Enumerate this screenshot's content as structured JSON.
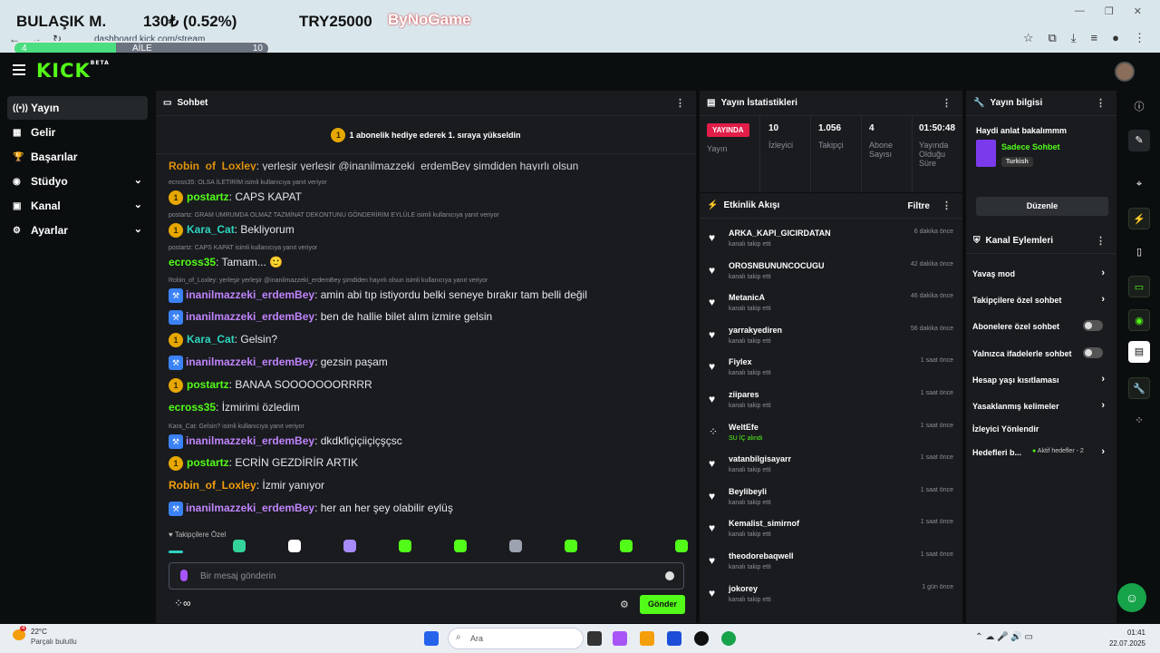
{
  "browser": {
    "url": "dashboard.kick.com/stream",
    "ticker": {
      "stock": "BULAŞIK M.",
      "change": "130₺ (0.52%)",
      "goal": "TRY25000",
      "brand": "ByNoGame"
    },
    "progress": {
      "left": "4",
      "label": "AİLE",
      "right": "10",
      "fill_fraction": 0.4
    }
  },
  "header": {
    "logo": "KICK",
    "logo_sup": "BETA"
  },
  "nav": {
    "items": [
      {
        "label": "Yayın",
        "icon": "broadcast-icon"
      },
      {
        "label": "Gelir",
        "icon": "revenue-icon"
      },
      {
        "label": "Başarılar",
        "icon": "trophy-icon"
      },
      {
        "label": "Stüdyo",
        "icon": "studio-icon"
      },
      {
        "label": "Kanal",
        "icon": "channel-icon"
      },
      {
        "label": "Ayarlar",
        "icon": "gear-icon"
      }
    ]
  },
  "chat": {
    "title": "Sohbet",
    "pinned": "1 abonelik hediye ederek 1. sıraya yükseldin",
    "pinned_badge": "1",
    "top_partial": {
      "user": "Robin_of_Loxley",
      "text": ": yerleşir yerleşir @inanilmazzeki_erdemBey şimdiden hayırlı olsun"
    },
    "messages": [
      {
        "reply": "ecross35: OLSA İLETİRİM isimli kullanıcıya yanıt veriyor",
        "badge": "1",
        "user": "postartz",
        "color": "#53fc18",
        "text": ": CAPS KAPAT"
      },
      {
        "reply": "postartz: GRAM UMRUMDA OLMAZ TAZMİNAT DEKONTUNU GÖNDERİRİM EYLÜLE isimli kullanıcıya yanıt veriyor",
        "badge": "1",
        "user": "Kara_Cat",
        "color": "#2dd4bf",
        "text": ": Bekliyorum"
      },
      {
        "reply": "postartz: CAPS KAPAT isimli kullanıcıya yanıt veriyor",
        "badge": "",
        "user": "ecross35",
        "color": "#53fc18",
        "text": ": Tamam... 🙂"
      },
      {
        "reply": "Robin_of_Loxley: yerleşir yerleşir @inanilmazzeki_erdemBey şimdiden hayırlı olsun isimli kullanıcıya yanıt veriyor",
        "badge": "b",
        "user": "inanilmazzeki_erdemBey",
        "color": "#c084fc",
        "text": ": amin abi tıp istiyordu belki seneye bırakır tam belli değil"
      },
      {
        "reply": "",
        "badge": "b",
        "user": "inanilmazzeki_erdemBey",
        "color": "#c084fc",
        "text": ": ben de hallie bilet alım izmire gelsin"
      },
      {
        "reply": "",
        "badge": "1",
        "user": "Kara_Cat",
        "color": "#2dd4bf",
        "text": ": Gelsin?"
      },
      {
        "reply": "",
        "badge": "b",
        "user": "inanilmazzeki_erdemBey",
        "color": "#c084fc",
        "text": ": gezsin paşam"
      },
      {
        "reply": "",
        "badge": "1",
        "user": "postartz",
        "color": "#53fc18",
        "text": ": BANAA SOOOOOOORRRR"
      },
      {
        "reply": "",
        "badge": "",
        "user": "ecross35",
        "color": "#53fc18",
        "text": ": İzmirimi özledim"
      },
      {
        "reply": "Kara_Cat: Gelsin? isimli kullanıcıya yanıt veriyor",
        "badge": "b",
        "user": "inanilmazzeki_erdemBey",
        "color": "#c084fc",
        "text": ": dkdkfiçiçiiçiçşçsc"
      },
      {
        "reply": "",
        "badge": "1",
        "user": "postartz",
        "color": "#53fc18",
        "text": ": ECRİN GEZDİRİR ARTIK"
      },
      {
        "reply": "",
        "badge": "",
        "user": "Robin_of_Loxley",
        "color": "#f59e0b",
        "text": ": İzmir yanıyor"
      },
      {
        "reply": "",
        "badge": "b",
        "user": "inanilmazzeki_erdemBey",
        "color": "#c084fc",
        "text": ": her an her şey olabilir eylüş"
      }
    ],
    "followers_only": "♥ Takipçilere Özel",
    "placeholder": "Bir mesaj gönderin",
    "send_label": "Gönder",
    "emote_colors": [
      "#2dd4bf",
      "#34d399",
      "#ffffff",
      "#a78bfa",
      "#53fc18",
      "#53fc18",
      "#9ca3af",
      "#53fc18",
      "#53fc18",
      "#53fc18"
    ]
  },
  "stats": {
    "title": "Yayın İstatistikleri",
    "live_label": "YAYINDA",
    "live_sub": "Yayın",
    "viewers": "10",
    "viewers_label": "İzleyici",
    "followers": "1.056",
    "followers_label": "Takipçi",
    "subs": "4",
    "subs_label": "Abone Sayısı",
    "duration": "01:50:48",
    "duration_label": "Yayında Olduğu Süre"
  },
  "activity": {
    "title": "Etkinlik Akışı",
    "filter": "Filtre",
    "items": [
      {
        "name": "ARKA_KAPI_GICIRDATAN",
        "sub": "kanalı takip etti",
        "time": "6 dakika önce"
      },
      {
        "name": "OROSNBUNUNCOCUGU",
        "sub": "kanalı takip etti",
        "time": "42 dakika önce"
      },
      {
        "name": "MetanicA",
        "sub": "kanalı takip etti",
        "time": "46 dakika önce"
      },
      {
        "name": "yarrakyediren",
        "sub": "kanalı takip etti",
        "time": "56 dakika önce"
      },
      {
        "name": "Fiylex",
        "sub": "kanalı takip etti",
        "time": "1 saat önce"
      },
      {
        "name": "ziipares",
        "sub": "kanalı takip etti",
        "time": "1 saat önce"
      },
      {
        "name": "WeltEfe",
        "sub": "SU İÇ alındı",
        "time": "1 saat önce"
      },
      {
        "name": "vatanbilgisayarr",
        "sub": "kanalı takip etti",
        "time": "1 saat önce"
      },
      {
        "name": "Beylibeyli",
        "sub": "kanalı takip etti",
        "time": "1 saat önce"
      },
      {
        "name": "Kemalist_simirnof",
        "sub": "kanalı takip etti",
        "time": "1 saat önce"
      },
      {
        "name": "theodorebaqwell",
        "sub": "kanalı takip etti",
        "time": "1 saat önce"
      },
      {
        "name": "jokorey",
        "sub": "kanalı takip etti",
        "time": "1 gün önce"
      }
    ]
  },
  "stream_info": {
    "title": "Yayın bilgisi",
    "stream_title": "Haydi anlat bakalımmm",
    "category": "Sadece Sohbet",
    "language": "Turkish",
    "edit_label": "Düzenle"
  },
  "channel_actions": {
    "title": "Kanal Eylemleri",
    "items": [
      {
        "label": "Yavaş mod",
        "kind": "arrow"
      },
      {
        "label": "Takipçilere özel sohbet",
        "kind": "arrow"
      },
      {
        "label": "Abonelere özel sohbet",
        "kind": "toggle"
      },
      {
        "label": "Yalnızca ifadelerle sohbet",
        "kind": "toggle"
      },
      {
        "label": "Hesap yaşı kısıtlaması",
        "kind": "arrow"
      },
      {
        "label": "Yasaklanmış kelimeler",
        "kind": "arrow"
      },
      {
        "label": "İzleyici Yönlendir",
        "kind": "none"
      },
      {
        "label": "Hedefleri b...",
        "kind": "arrow"
      }
    ],
    "goals_status": "Aktif hedefler - 2"
  },
  "taskbar": {
    "temp": "22°C",
    "weather": "Parçalı bulutlu",
    "weather_badge": "4",
    "search": "Ara",
    "time": "01:41",
    "date": "22.07.2025"
  }
}
